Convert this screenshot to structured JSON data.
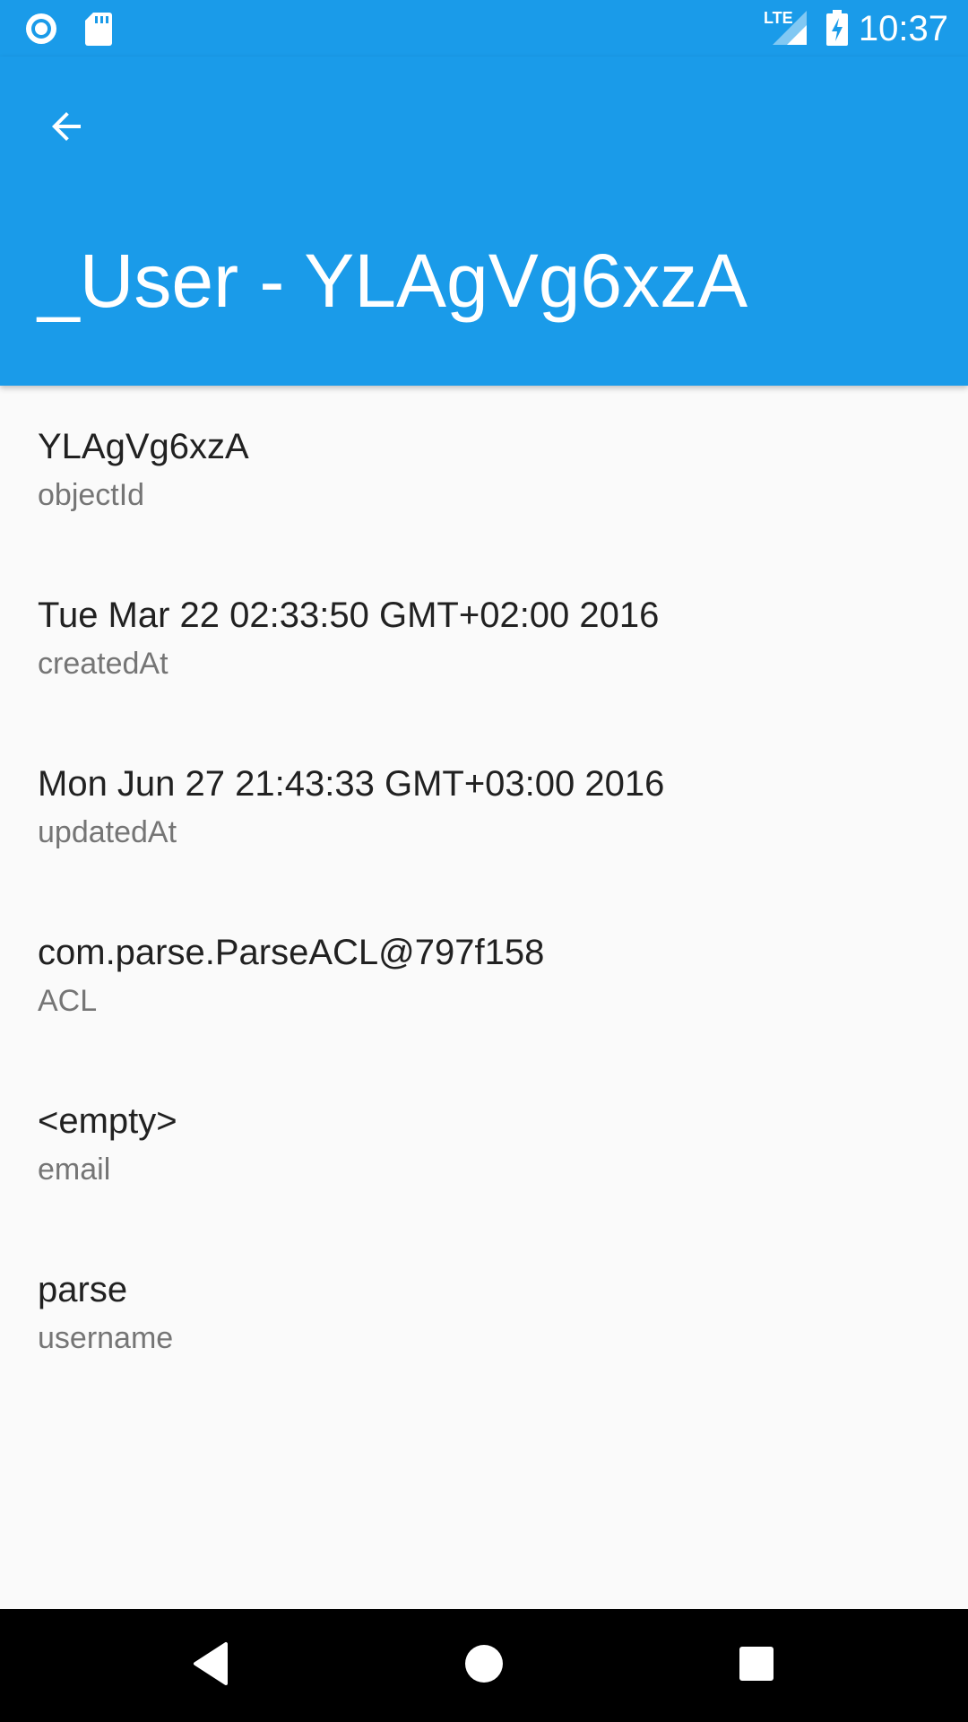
{
  "status_bar": {
    "time": "10:37",
    "network": "LTE",
    "icons": [
      "record-icon",
      "sd-card-icon",
      "signal-icon",
      "battery-charging-icon"
    ]
  },
  "app_bar": {
    "title": "_User - YLAgVg6xzA",
    "back_icon": "arrow-back-icon"
  },
  "fields": [
    {
      "value": "YLAgVg6xzA",
      "key": "objectId"
    },
    {
      "value": "Tue Mar 22 02:33:50 GMT+02:00 2016",
      "key": "createdAt"
    },
    {
      "value": "Mon Jun 27 21:43:33 GMT+03:00 2016",
      "key": "updatedAt"
    },
    {
      "value": "com.parse.ParseACL@797f158",
      "key": "ACL"
    },
    {
      "value": "<empty>",
      "key": "email"
    },
    {
      "value": "parse",
      "key": "username"
    }
  ],
  "nav_bar": {
    "icons": [
      "back-triangle-icon",
      "home-circle-icon",
      "recents-square-icon"
    ]
  },
  "colors": {
    "primary": "#1a9be9",
    "background": "#fafafa",
    "text_primary": "#212121",
    "text_secondary": "#757575"
  }
}
